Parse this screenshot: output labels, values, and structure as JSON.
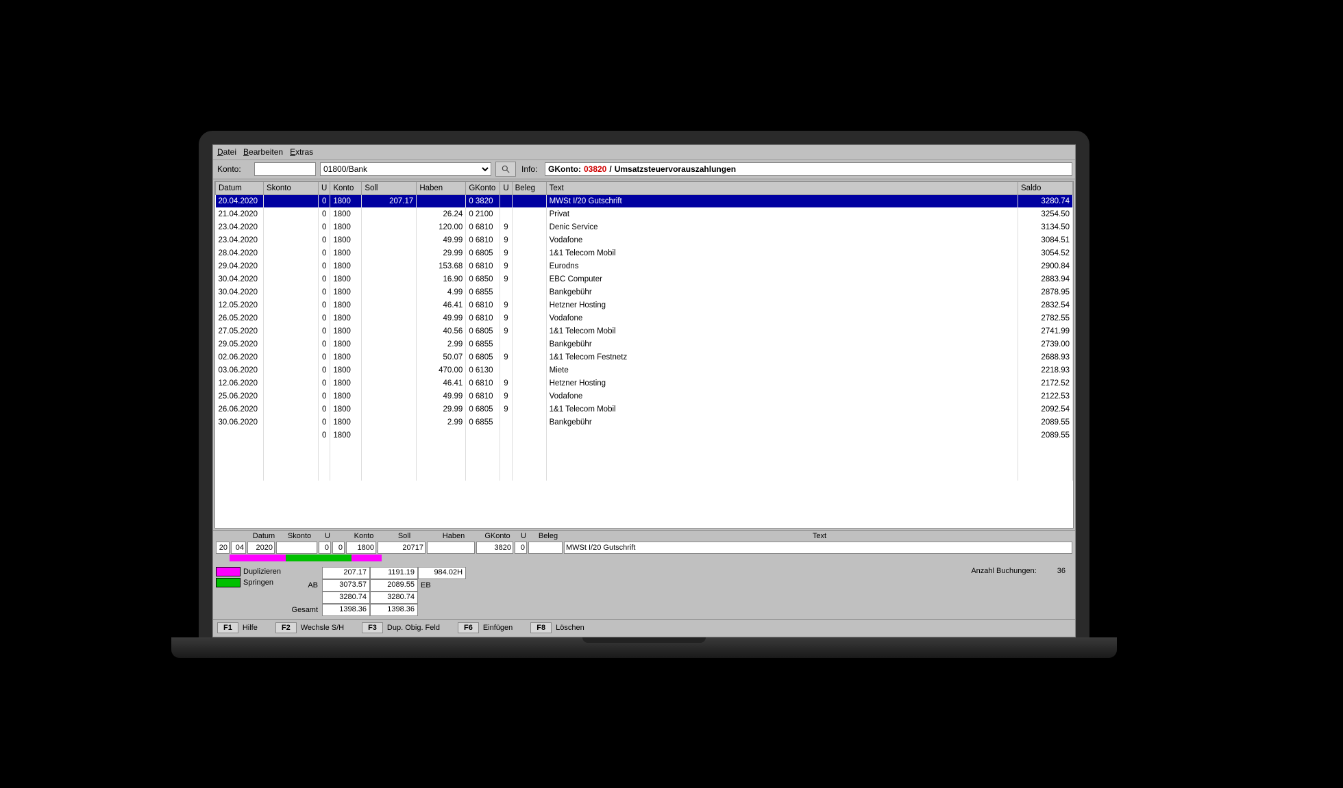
{
  "menu": {
    "datei": "Datei",
    "bearbeiten": "Bearbeiten",
    "extras": "Extras"
  },
  "toolbar": {
    "konto_label": "Konto:",
    "konto_value": "",
    "konto_select": "01800/Bank",
    "info_label": "Info:",
    "info_prefix": "GKonto:",
    "info_account": "03820",
    "info_sep": "/",
    "info_desc": "Umsatzsteuervorauszahlungen"
  },
  "headers": [
    "Datum",
    "Skonto",
    "U",
    "Konto",
    "Soll",
    "Haben",
    "GKonto",
    "U",
    "Beleg",
    "Text",
    "Saldo"
  ],
  "rows": [
    {
      "datum": "20.04.2020",
      "skonto": "",
      "u": "0",
      "konto": "1800",
      "soll": "207.17",
      "haben": "",
      "gkonto_u": "0",
      "gkonto": "3820",
      "u2": "",
      "beleg": "",
      "text": "MWSt I/20 Gutschrift",
      "saldo": "3280.74",
      "sel": true
    },
    {
      "datum": "21.04.2020",
      "skonto": "",
      "u": "0",
      "konto": "1800",
      "soll": "",
      "haben": "26.24",
      "gkonto_u": "0",
      "gkonto": "2100",
      "u2": "",
      "beleg": "",
      "text": "Privat",
      "saldo": "3254.50"
    },
    {
      "datum": "23.04.2020",
      "skonto": "",
      "u": "0",
      "konto": "1800",
      "soll": "",
      "haben": "120.00",
      "gkonto_u": "0",
      "gkonto": "6810",
      "u2": "9",
      "beleg": "",
      "text": "Denic Service",
      "saldo": "3134.50"
    },
    {
      "datum": "23.04.2020",
      "skonto": "",
      "u": "0",
      "konto": "1800",
      "soll": "",
      "haben": "49.99",
      "gkonto_u": "0",
      "gkonto": "6810",
      "u2": "9",
      "beleg": "",
      "text": "Vodafone",
      "saldo": "3084.51"
    },
    {
      "datum": "28.04.2020",
      "skonto": "",
      "u": "0",
      "konto": "1800",
      "soll": "",
      "haben": "29.99",
      "gkonto_u": "0",
      "gkonto": "6805",
      "u2": "9",
      "beleg": "",
      "text": "1&1 Telecom Mobil",
      "saldo": "3054.52"
    },
    {
      "datum": "29.04.2020",
      "skonto": "",
      "u": "0",
      "konto": "1800",
      "soll": "",
      "haben": "153.68",
      "gkonto_u": "0",
      "gkonto": "6810",
      "u2": "9",
      "beleg": "",
      "text": "Eurodns",
      "saldo": "2900.84"
    },
    {
      "datum": "30.04.2020",
      "skonto": "",
      "u": "0",
      "konto": "1800",
      "soll": "",
      "haben": "16.90",
      "gkonto_u": "0",
      "gkonto": "6850",
      "u2": "9",
      "beleg": "",
      "text": "EBC Computer",
      "saldo": "2883.94"
    },
    {
      "datum": "30.04.2020",
      "skonto": "",
      "u": "0",
      "konto": "1800",
      "soll": "",
      "haben": "4.99",
      "gkonto_u": "0",
      "gkonto": "6855",
      "u2": "",
      "beleg": "",
      "text": "Bankgebühr",
      "saldo": "2878.95"
    },
    {
      "datum": "12.05.2020",
      "skonto": "",
      "u": "0",
      "konto": "1800",
      "soll": "",
      "haben": "46.41",
      "gkonto_u": "0",
      "gkonto": "6810",
      "u2": "9",
      "beleg": "",
      "text": "Hetzner Hosting",
      "saldo": "2832.54"
    },
    {
      "datum": "26.05.2020",
      "skonto": "",
      "u": "0",
      "konto": "1800",
      "soll": "",
      "haben": "49.99",
      "gkonto_u": "0",
      "gkonto": "6810",
      "u2": "9",
      "beleg": "",
      "text": "Vodafone",
      "saldo": "2782.55"
    },
    {
      "datum": "27.05.2020",
      "skonto": "",
      "u": "0",
      "konto": "1800",
      "soll": "",
      "haben": "40.56",
      "gkonto_u": "0",
      "gkonto": "6805",
      "u2": "9",
      "beleg": "",
      "text": "1&1 Telecom Mobil",
      "saldo": "2741.99"
    },
    {
      "datum": "29.05.2020",
      "skonto": "",
      "u": "0",
      "konto": "1800",
      "soll": "",
      "haben": "2.99",
      "gkonto_u": "0",
      "gkonto": "6855",
      "u2": "",
      "beleg": "",
      "text": "Bankgebühr",
      "saldo": "2739.00"
    },
    {
      "datum": "02.06.2020",
      "skonto": "",
      "u": "0",
      "konto": "1800",
      "soll": "",
      "haben": "50.07",
      "gkonto_u": "0",
      "gkonto": "6805",
      "u2": "9",
      "beleg": "",
      "text": "1&1 Telecom Festnetz",
      "saldo": "2688.93"
    },
    {
      "datum": "03.06.2020",
      "skonto": "",
      "u": "0",
      "konto": "1800",
      "soll": "",
      "haben": "470.00",
      "gkonto_u": "0",
      "gkonto": "6130",
      "u2": "",
      "beleg": "",
      "text": "Miete",
      "saldo": "2218.93"
    },
    {
      "datum": "12.06.2020",
      "skonto": "",
      "u": "0",
      "konto": "1800",
      "soll": "",
      "haben": "46.41",
      "gkonto_u": "0",
      "gkonto": "6810",
      "u2": "9",
      "beleg": "",
      "text": "Hetzner Hosting",
      "saldo": "2172.52"
    },
    {
      "datum": "25.06.2020",
      "skonto": "",
      "u": "0",
      "konto": "1800",
      "soll": "",
      "haben": "49.99",
      "gkonto_u": "0",
      "gkonto": "6810",
      "u2": "9",
      "beleg": "",
      "text": "Vodafone",
      "saldo": "2122.53"
    },
    {
      "datum": "26.06.2020",
      "skonto": "",
      "u": "0",
      "konto": "1800",
      "soll": "",
      "haben": "29.99",
      "gkonto_u": "0",
      "gkonto": "6805",
      "u2": "9",
      "beleg": "",
      "text": "1&1 Telecom Mobil",
      "saldo": "2092.54"
    },
    {
      "datum": "30.06.2020",
      "skonto": "",
      "u": "0",
      "konto": "1800",
      "soll": "",
      "haben": "2.99",
      "gkonto_u": "0",
      "gkonto": "6855",
      "u2": "",
      "beleg": "",
      "text": "Bankgebühr",
      "saldo": "2089.55"
    },
    {
      "datum": "",
      "skonto": "",
      "u": "0",
      "konto": "1800",
      "soll": "",
      "haben": "",
      "gkonto_u": "",
      "gkonto": "",
      "u2": "",
      "beleg": "",
      "text": "",
      "saldo": "2089.55"
    }
  ],
  "entry_labels": [
    "",
    "",
    "Datum",
    "Skonto",
    "U",
    "",
    "Konto",
    "Soll",
    "Haben",
    "GKonto",
    "U",
    "Beleg",
    "Text"
  ],
  "entry": {
    "d": "20",
    "m": "04",
    "y": "2020",
    "skonto": "",
    "u": "0",
    "u0": "0",
    "konto": "1800",
    "soll": "20717",
    "haben": "",
    "gkonto": "3820",
    "gu": "0",
    "beleg": "",
    "text": "MWSt I/20 Gutschrift"
  },
  "legend": {
    "dup": "Duplizieren",
    "spr": "Springen"
  },
  "sums": {
    "ab_label": "AB",
    "eb_label": "EB",
    "gesamt_label": "Gesamt",
    "r1c1": "207.17",
    "r1c2": "1191.19",
    "r1c3": "984.02H",
    "r2c1": "3073.57",
    "r2c2": "2089.55",
    "r3c1": "3280.74",
    "r3c2": "3280.74",
    "r4c1": "1398.36",
    "r4c2": "1398.36"
  },
  "count": {
    "label": "Anzahl Buchungen:",
    "value": "36"
  },
  "fkeys": {
    "f1": "F1",
    "f1l": "Hilfe",
    "f2": "F2",
    "f2l": "Wechsle S/H",
    "f3": "F3",
    "f3l": "Dup. Obig. Feld",
    "f6": "F6",
    "f6l": "Einfügen",
    "f8": "F8",
    "f8l": "Löschen"
  }
}
